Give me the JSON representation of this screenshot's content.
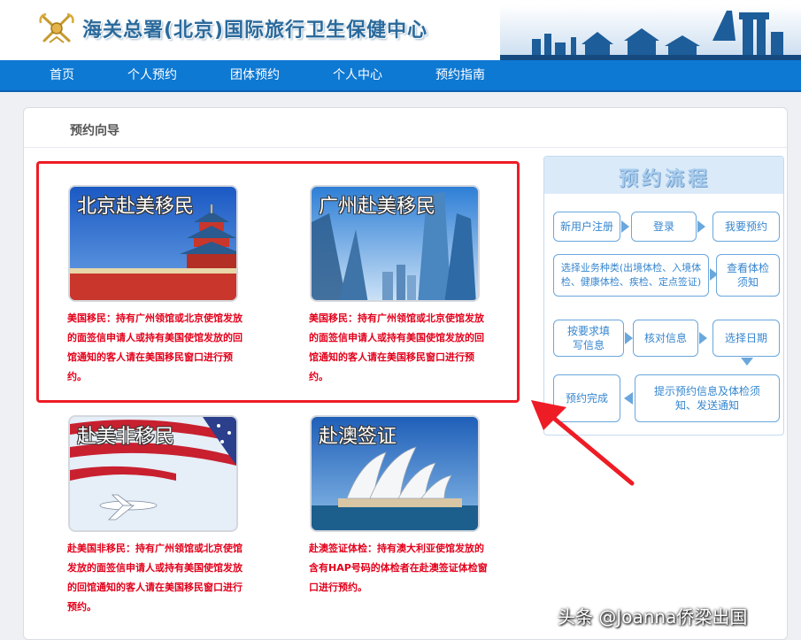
{
  "header": {
    "site_title": "海关总署(北京)国际旅行卫生保健中心"
  },
  "nav": {
    "items": [
      "首页",
      "个人预约",
      "团体预约",
      "个人中心",
      "预约指南"
    ]
  },
  "panel": {
    "title": "预约向导"
  },
  "cards": [
    {
      "label": "北京赴美移民",
      "desc": "美国移民：持有广州领馆或北京使馆发放的面签信申请人或持有美国使馆发放的回馆通知的客人请在美国移民窗口进行预约。"
    },
    {
      "label": "广州赴美移民",
      "desc": "美国移民：持有广州领馆或北京使馆发放的面签信申请人或持有美国使馆发放的回馆通知的客人请在美国移民窗口进行预约。"
    },
    {
      "label": "赴美非移民",
      "desc": "赴美国非移民：持有广州领馆或北京使馆发放的面签信申请人或持有美国使馆发放的回馆通知的客人请在美国移民窗口进行预约。"
    },
    {
      "label": "赴澳签证",
      "desc": "赴澳签证体检：持有澳大利亚使馆发放的含有HAP号码的体检者在赴澳签证体检窗口进行预约。"
    }
  ],
  "process": {
    "title": "预约流程",
    "steps": [
      "新用户注册",
      "登录",
      "我要预约",
      "选择业务种类(出境体检、入境体检、健康体检、疾检、定点签证)",
      "查看体检须知",
      "按要求填写信息",
      "核对信息",
      "选择日期",
      "预约完成",
      "提示预约信息及体检须知、发送通知"
    ]
  },
  "watermark": "头条 @Joanna侨梁出国",
  "colors": {
    "nav_bg": "#0e79d3",
    "highlight": "#ee1c25",
    "desc_text": "#e3001b",
    "step_text": "#3686cf"
  }
}
